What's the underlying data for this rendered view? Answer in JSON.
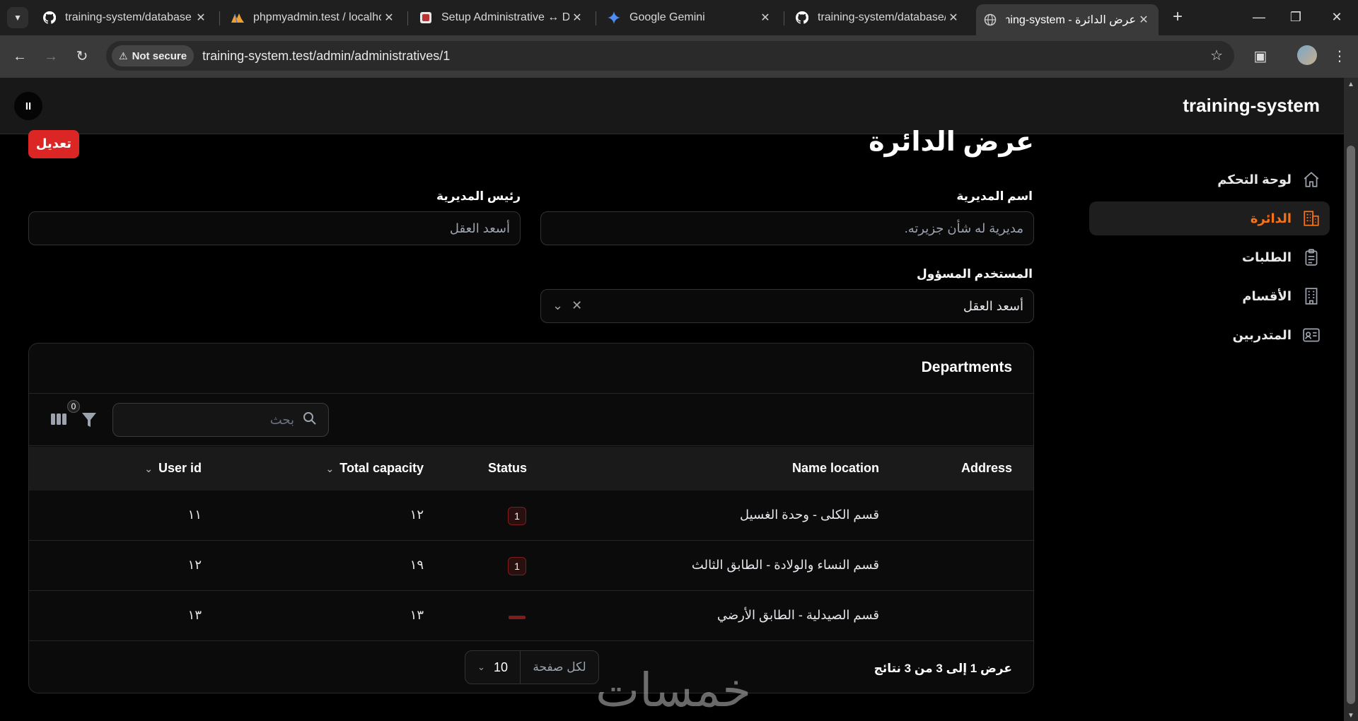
{
  "browser": {
    "tabs": [
      {
        "title": "training-system/database a",
        "icon": "github-icon"
      },
      {
        "title": "phpmyadmin.test / localho",
        "icon": "phpmyadmin-icon"
      },
      {
        "title": "Setup Administrative ↔ De",
        "icon": "app-icon"
      },
      {
        "title": "Google Gemini",
        "icon": "gemini-icon"
      },
      {
        "title": "training-system/database/",
        "icon": "github-icon"
      },
      {
        "title": "عرض الدائرة - ining-system",
        "icon": "globe-icon"
      }
    ],
    "security_label": "Not secure",
    "url": "training-system.test/admin/administratives/1"
  },
  "app": {
    "brand": "training-system",
    "pause_label": "II"
  },
  "sidebar": {
    "items": [
      {
        "label": "لوحة التحكم",
        "icon": "home-icon"
      },
      {
        "label": "الدائرة",
        "icon": "building-icon",
        "active": true
      },
      {
        "label": "الطلبات",
        "icon": "clipboard-icon"
      },
      {
        "label": "الأقسام",
        "icon": "office-icon"
      },
      {
        "label": "المتدربين",
        "icon": "id-card-icon"
      }
    ],
    "active_color": "#f97316"
  },
  "page": {
    "title": "عرض الدائرة",
    "edit_label": "تعديل",
    "edit_color": "#dc2626",
    "fields": {
      "directorate_name_label": "اسم المديرية",
      "directorate_name_value": "مديرية له شأن جزيرته.",
      "head_label": "رئيس المديرية",
      "head_value": "أسعد العقل",
      "responsible_user_label": "المستخدم المسؤول",
      "responsible_user_value": "أسعد العقل"
    }
  },
  "departments": {
    "title": "Departments",
    "search_placeholder": "بحث",
    "filter_count": "0",
    "columns": {
      "address": "Address",
      "name_location": "Name location",
      "status": "Status",
      "total_capacity": "Total capacity",
      "user_id": "User id"
    },
    "rows": [
      {
        "address": "",
        "name_location": "قسم الكلى - وحدة الغسيل",
        "status": "1",
        "total_capacity": "١٢",
        "user_id": "١١"
      },
      {
        "address": "",
        "name_location": "قسم النساء والولادة - الطابق الثالث",
        "status": "1",
        "total_capacity": "١٩",
        "user_id": "١٢"
      },
      {
        "address": "",
        "name_location": "قسم الصيدلية - الطابق الأرضي",
        "status": "",
        "total_capacity": "١٣",
        "user_id": "١٣"
      }
    ],
    "results_text": "عرض 1 إلى 3 من 3 نتائج",
    "per_page_label": "لكل صفحة",
    "per_page_value": "10"
  },
  "watermark": "خمسات"
}
